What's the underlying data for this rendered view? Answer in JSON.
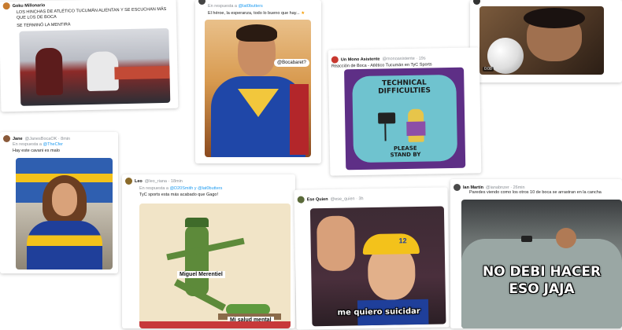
{
  "posts": [
    {
      "user": "Goku Millonario",
      "handle": "",
      "text1": "LOS HINCHAS DE ATLÉTICO TUCUMÁN ALIENTAN Y SE ESCUCHAN MÁS",
      "text2": "QUE LOS DE BOCA",
      "text3": "SE TERMINÓ LA MENTIRA"
    },
    {
      "user": "",
      "handle": "",
      "reply_prefix": "En respuesta a",
      "reply_to": "@lat0butters",
      "text": "El héroe, la esperanza, todo lo bueno que hay...",
      "tag": "@Bocabaret?"
    },
    {
      "user": "Un Mono Asistente",
      "handle": "@monoasistente · 19s",
      "text": "Reacción de Boca - Atlético Tucumán en TyC Sports",
      "sign_lines": [
        "TECHNICAL",
        "DIFFICULTIES"
      ],
      "sign_bottom": [
        "PLEASE",
        "STAND BY"
      ]
    },
    {
      "user": "Jane",
      "handle": "@JanesBocaOK · 8min",
      "reply_prefix": "En respuesta a",
      "reply_to": "@TheCfer",
      "text": "Hay este cavani es malo"
    },
    {
      "user": "Leo",
      "handle": "@leo_riana · 18min",
      "reply_prefix": "En respuesta a",
      "reply_to": "@D20Smith y @lat0butters",
      "text": "TyC sports esta más acabado que Gago!",
      "label_a": "Miguel Merentiel",
      "label_b": "Mi salud mental"
    },
    {
      "user": "Ese Quien",
      "handle": "@ese_quien · 3h",
      "number": "12",
      "caption": "me quiero suicidar"
    },
    {
      "user": "Ian Martín",
      "handle": "@ianabnzer · 26min",
      "text": "Paredes viendo como los otros 10 de boca se arrastran en la cancha",
      "caption1": "NO DEBI HACER",
      "caption2": "ESO JAJA"
    }
  ],
  "video_time": "0:08",
  "colors": {
    "link": "#1d9bf0",
    "boca_blue": "#1f3f9a",
    "boca_yellow": "#f3c21b",
    "tv_purple": "#5e2f86"
  }
}
